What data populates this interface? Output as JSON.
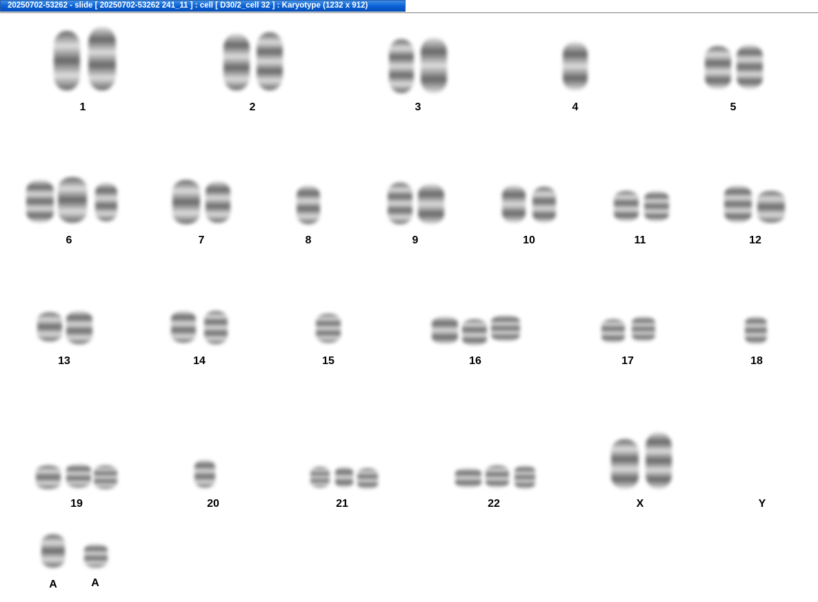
{
  "window": {
    "title": "20250702-53262 - slide [ 20250702-53262 241_11 ] : cell [ D30/2_cell 32 ] : Karyotype  (1232 x 912)"
  },
  "colors": {
    "title_bar": "#0a5fd6",
    "title_text": "#ffffff",
    "background": "#ffffff",
    "chromosome_dark": "#3a3a3a",
    "chromosome_light": "#d8d8d8"
  },
  "karyotype": {
    "groups": [
      {
        "label": "1",
        "count": 2
      },
      {
        "label": "2",
        "count": 2
      },
      {
        "label": "3",
        "count": 2
      },
      {
        "label": "4",
        "count": 1
      },
      {
        "label": "5",
        "count": 2
      },
      {
        "label": "6",
        "count": 3
      },
      {
        "label": "7",
        "count": 2
      },
      {
        "label": "8",
        "count": 1
      },
      {
        "label": "9",
        "count": 2
      },
      {
        "label": "10",
        "count": 2
      },
      {
        "label": "11",
        "count": 2
      },
      {
        "label": "12",
        "count": 2
      },
      {
        "label": "13",
        "count": 2
      },
      {
        "label": "14",
        "count": 2
      },
      {
        "label": "15",
        "count": 1
      },
      {
        "label": "16",
        "count": 3
      },
      {
        "label": "17",
        "count": 2
      },
      {
        "label": "18",
        "count": 1
      },
      {
        "label": "19",
        "count": 3
      },
      {
        "label": "20",
        "count": 1
      },
      {
        "label": "21",
        "count": 3
      },
      {
        "label": "22",
        "count": 3
      },
      {
        "label": "X",
        "count": 2
      },
      {
        "label": "Y",
        "count": 0
      },
      {
        "label": "A",
        "count": 1
      },
      {
        "label": "A",
        "count": 1
      }
    ]
  }
}
